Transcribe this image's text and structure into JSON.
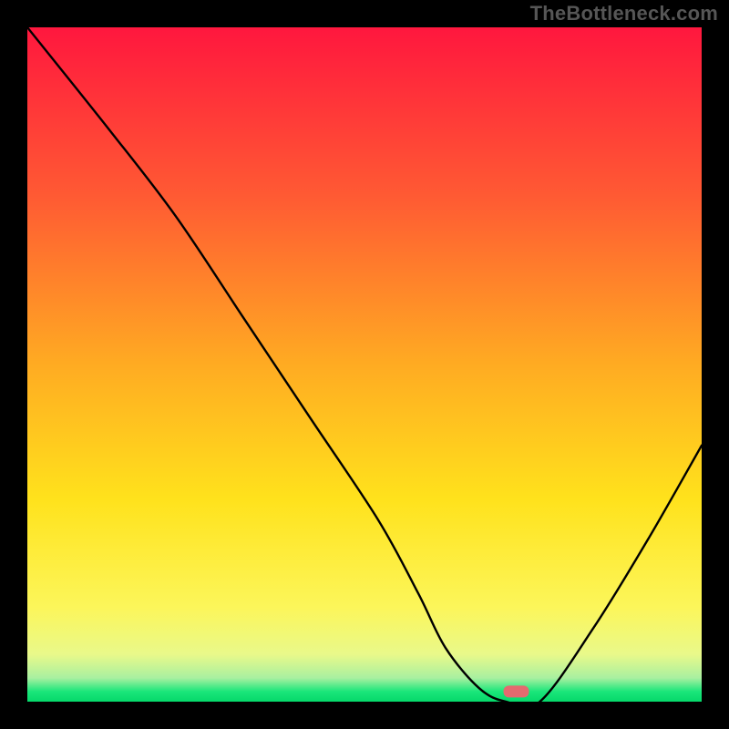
{
  "watermark": "TheBottleneck.com",
  "chart_data": {
    "type": "line",
    "title": "",
    "xlabel": "",
    "ylabel": "",
    "xlim": [
      0,
      100
    ],
    "ylim": [
      0,
      100
    ],
    "grid": false,
    "legend": false,
    "background_gradient_notes": "vertical gradient: top red → orange → yellow → pale-yellow → thin green strip at bottom",
    "background_gradient_stops": [
      {
        "pos": 0.0,
        "color": "#ff173e"
      },
      {
        "pos": 0.25,
        "color": "#ff5a33"
      },
      {
        "pos": 0.5,
        "color": "#ffab22"
      },
      {
        "pos": 0.7,
        "color": "#ffe21c"
      },
      {
        "pos": 0.86,
        "color": "#fcf65a"
      },
      {
        "pos": 0.93,
        "color": "#e9f98a"
      },
      {
        "pos": 0.965,
        "color": "#a8f0a0"
      },
      {
        "pos": 0.985,
        "color": "#1ae67a"
      },
      {
        "pos": 1.0,
        "color": "#05d86a"
      }
    ],
    "series": [
      {
        "name": "bottleneck-curve",
        "stroke": "#000000",
        "x": [
          0,
          12,
          22,
          32,
          42,
          52,
          58,
          62,
          67,
          71,
          76,
          84,
          92,
          100
        ],
        "y": [
          100,
          85,
          72,
          57,
          42,
          27,
          16,
          8,
          2,
          0,
          0,
          11,
          24,
          38
        ]
      }
    ],
    "marker": {
      "name": "optimal-point",
      "x": 72.5,
      "y": 1.5,
      "color": "#e46a6f",
      "shape": "pill"
    }
  }
}
